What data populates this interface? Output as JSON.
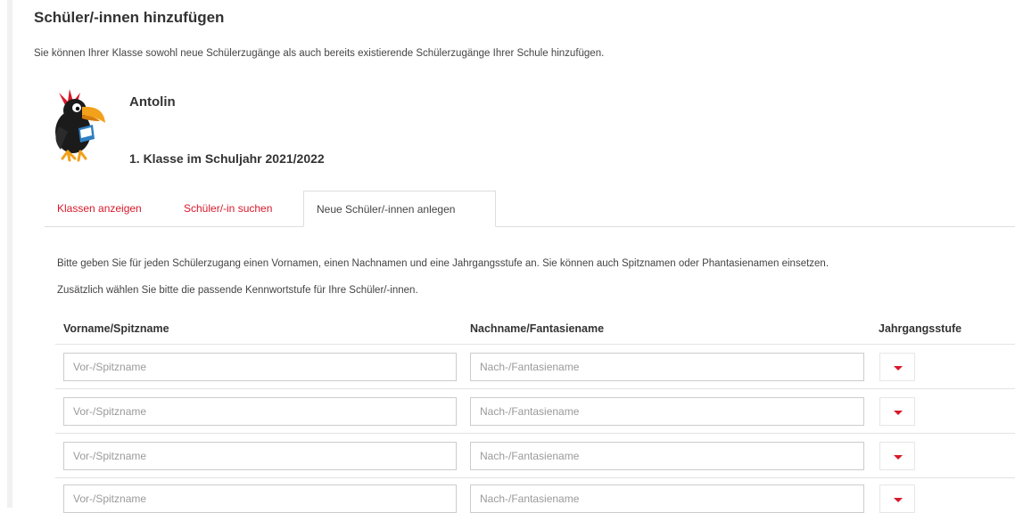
{
  "page": {
    "title": "Schüler/-innen hinzufügen",
    "intro": "Sie können Ihrer Klasse sowohl neue Schülerzugänge als auch bereits existierende Schülerzugänge Ihrer Schule hinzufügen."
  },
  "header": {
    "app_name": "Antolin",
    "class_name": "1. Klasse im Schuljahr 2021/2022",
    "mascot_icon": "raven-mascot-icon"
  },
  "tabs": [
    {
      "label": "Klassen anzeigen",
      "active": false
    },
    {
      "label": "Schüler/-in suchen",
      "active": false
    },
    {
      "label": "Neue Schüler/-innen anlegen",
      "active": true
    }
  ],
  "instructions": [
    "Bitte geben Sie für jeden Schülerzugang einen Vornamen, einen Nachnamen und eine Jahrgangsstufe an. Sie können auch Spitznamen oder Phantasienamen einsetzen.",
    "Zusätzlich wählen Sie bitte die passende Kennwortstufe für Ihre Schüler/-innen."
  ],
  "table": {
    "columns": [
      "Vorname/Spitzname",
      "Nachname/Fantasiename",
      "Jahrgangsstufe"
    ],
    "rows": [
      {
        "first_placeholder": "Vor-/Spitzname",
        "last_placeholder": "Nach-/Fantasiename",
        "grade": ""
      },
      {
        "first_placeholder": "Vor-/Spitzname",
        "last_placeholder": "Nach-/Fantasiename",
        "grade": ""
      },
      {
        "first_placeholder": "Vor-/Spitzname",
        "last_placeholder": "Nach-/Fantasiename",
        "grade": ""
      },
      {
        "first_placeholder": "Vor-/Spitzname",
        "last_placeholder": "Nach-/Fantasiename",
        "grade": ""
      }
    ]
  },
  "colors": {
    "accent": "#d9182a",
    "text": "#333333",
    "border": "#cccccc"
  }
}
